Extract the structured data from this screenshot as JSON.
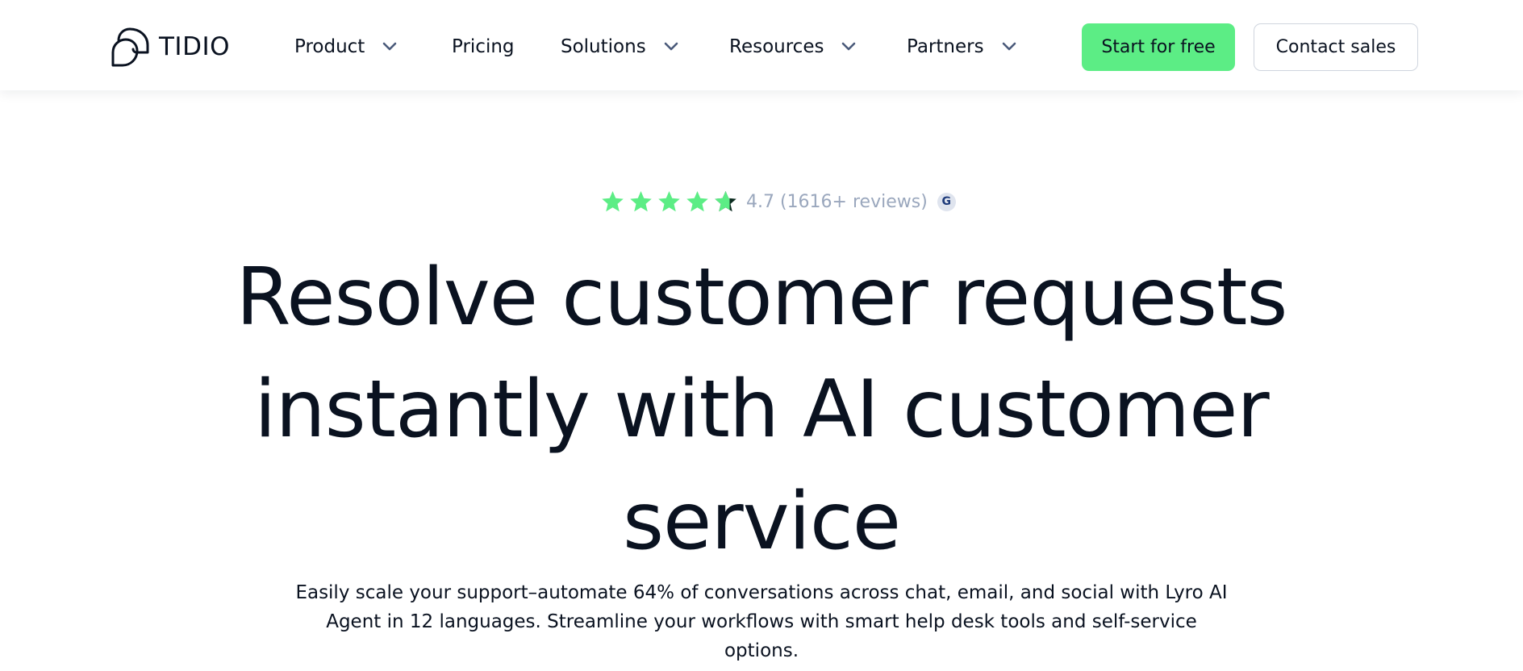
{
  "brand": {
    "name": "TIDIO",
    "logo_icon": "tidio-logo-icon"
  },
  "nav": {
    "items": [
      {
        "label": "Product",
        "has_dropdown": true
      },
      {
        "label": "Pricing",
        "has_dropdown": false
      },
      {
        "label": "Solutions",
        "has_dropdown": true
      },
      {
        "label": "Resources",
        "has_dropdown": true
      },
      {
        "label": "Partners",
        "has_dropdown": true
      }
    ],
    "dropdown_icon": "chevron-down-icon"
  },
  "cta": {
    "primary_label": "Start for free",
    "secondary_label": "Contact sales"
  },
  "rating": {
    "score": 4.7,
    "stars_max": 5,
    "text": "4.7 (1616+ reviews)",
    "badge_label": "G",
    "badge_icon": "g2-icon"
  },
  "hero": {
    "title_line_1": "Resolve customer requests",
    "title_line_2": "instantly with AI customer",
    "title_line_3": "service",
    "subtitle_line_1": "Easily scale your support–automate 64% of conversations across chat, email, and social with Lyro AI",
    "subtitle_line_2": "Agent in 12 languages. Streamline your workflows with smart help desk tools and self-service options."
  },
  "colors": {
    "accent": "#5ced85",
    "star": "#5ced85",
    "star_half_dark": "#0b2a1f",
    "text": "#0a1220",
    "muted": "#9aa7bd",
    "chevron": "#4a5a7a",
    "border": "#cfd5de"
  }
}
